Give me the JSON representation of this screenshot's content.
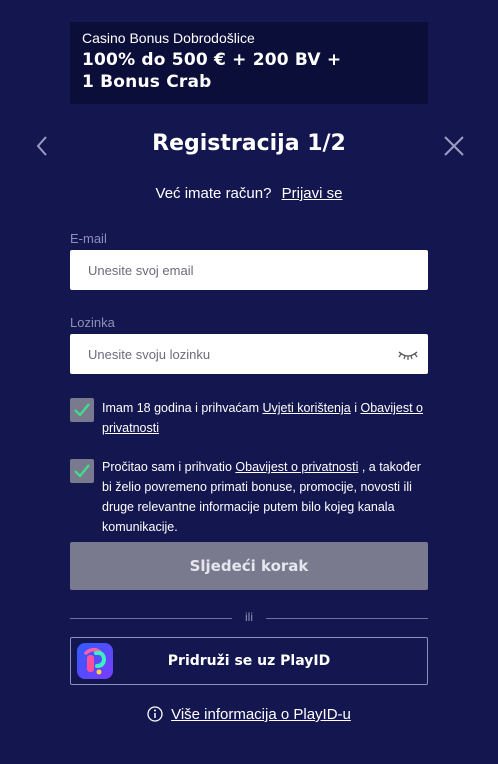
{
  "banner": {
    "subtitle": "Casino Bonus Dobrodošlice",
    "headline_line1": "100% do 500 € + 200 BV +",
    "headline_line2": "1 Bonus Crab"
  },
  "header": {
    "title": "Registracija 1/2",
    "back_icon": "chevron-left-icon",
    "close_icon": "close-icon"
  },
  "login": {
    "prompt": "Već imate račun?",
    "link": "Prijavi se"
  },
  "email": {
    "label": "E-mail",
    "placeholder": "Unesite svoj email",
    "value": ""
  },
  "password": {
    "label": "Lozinka",
    "placeholder": "Unesite svoju lozinku",
    "value": "",
    "toggle_icon": "eye-closed-icon"
  },
  "consent_terms": {
    "checked": true,
    "text_before": "Imam 18 godina i prihvaćam ",
    "link1": "Uvjeti korištenja",
    "text_middle": " i ",
    "link2": "Obavijest o privatnosti"
  },
  "consent_marketing": {
    "checked": true,
    "text_before": "Pročitao sam i prihvatio ",
    "link": "Obavijest o privatnosti",
    "text_after": " , a također bi želio povremeno primati bonuse, promocije, novosti ili druge relevantne informacije putem bilo kojeg kanala komunikacije."
  },
  "next_button": {
    "label": "Sljedeći korak"
  },
  "divider": {
    "label": "ili"
  },
  "playid": {
    "label": "Pridruži se uz PlayID",
    "logo_icon": "playid-logo-icon"
  },
  "info": {
    "icon": "info-icon",
    "link": "Više informacija o PlayID-u"
  },
  "colors": {
    "background": "#141650",
    "banner": "#0c0e3a",
    "disabled_button": "#7a7a8e",
    "muted_text": "#8d8fb8"
  }
}
